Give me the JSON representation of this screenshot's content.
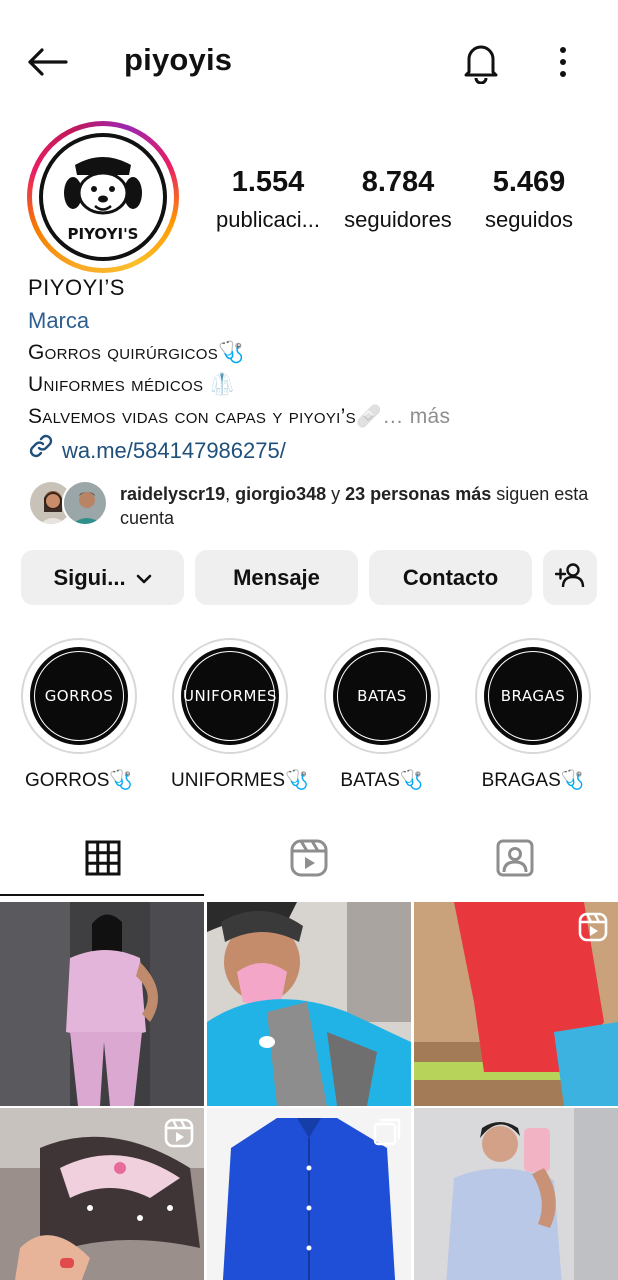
{
  "header": {
    "username": "piyoyis"
  },
  "profile": {
    "avatar_text": "PIYOYI'S",
    "stats": [
      {
        "value": "1.554",
        "label": "publicaci..."
      },
      {
        "value": "8.784",
        "label": "seguidores"
      },
      {
        "value": "5.469",
        "label": "seguidos"
      }
    ],
    "name": "PIYOYI’S",
    "category": "Marca",
    "bio_lines": [
      "Gorros quirúrgicos🩺",
      "Uniformes médicos 🥼",
      "Salvemos vidas con capas y piyoyi’s🩹"
    ],
    "more": "… más",
    "link": "wa.me/584147986275/"
  },
  "followed_by": {
    "user1": "raidelyscr19",
    "sep1": ", ",
    "user2": "giorgio348",
    "sep2": " y ",
    "others": "23 personas más",
    "rest": " siguen esta cuenta"
  },
  "buttons": {
    "following": "Sigui...",
    "message": "Mensaje",
    "contact": "Contacto"
  },
  "highlights": [
    {
      "circle_text": "GORROS",
      "label": "GORROS🩺"
    },
    {
      "circle_text": "UNIFORMES",
      "label": "UNIFORMES🩺"
    },
    {
      "circle_text": "BATAS",
      "label": "BATAS🩺"
    },
    {
      "circle_text": "BRAGAS",
      "label": "BRAGAS🩺"
    }
  ],
  "tabs": [
    "grid-icon",
    "reels-icon",
    "tagged-icon"
  ],
  "colors": {
    "link": "#1f4f7a",
    "category": "#2f5f8f",
    "button_bg": "#efefef",
    "muted": "#8e8e8e"
  }
}
